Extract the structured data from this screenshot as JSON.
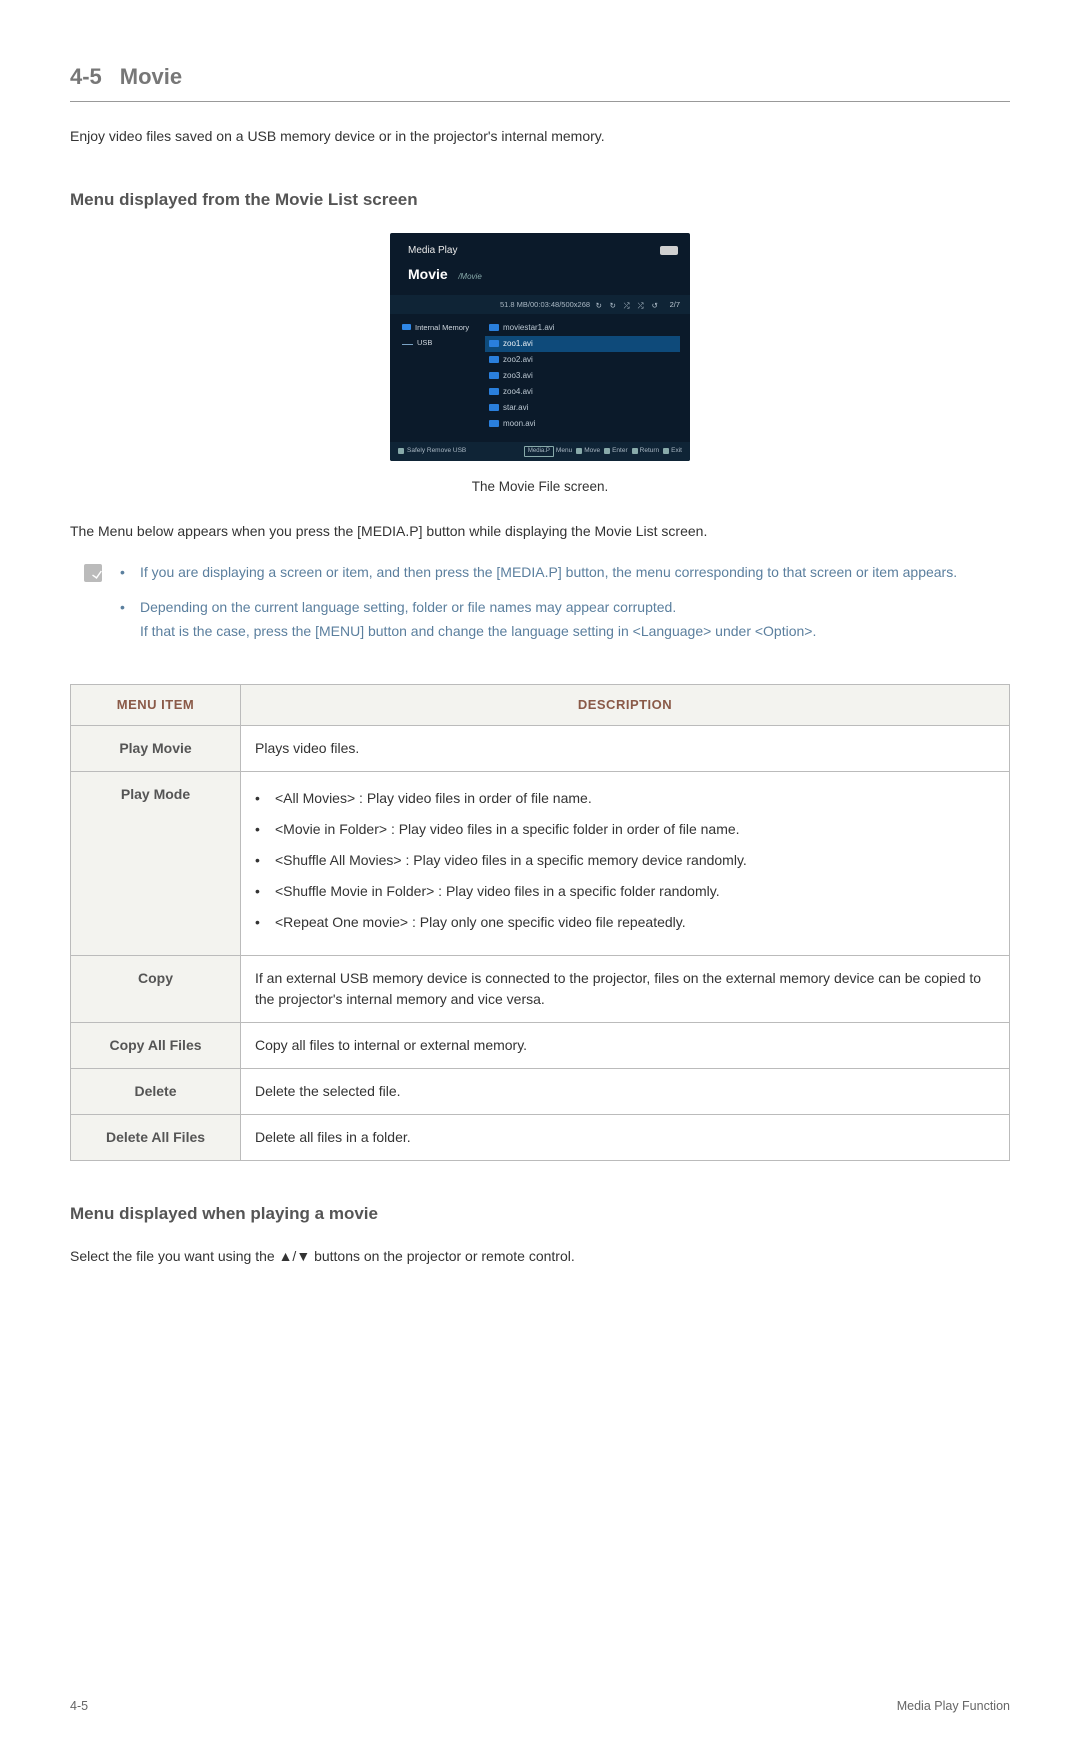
{
  "section": {
    "number": "4-5",
    "title": "Movie"
  },
  "intro": "Enjoy video files saved on a USB memory device or in the projector's internal memory.",
  "sub1": "Menu displayed from the Movie List screen",
  "screenshot": {
    "brand": "Media Play",
    "screen_title": "Movie",
    "breadcrumb": "/Movie",
    "info_bar": "51.8 MB/00:03:48/500x268",
    "page_indicator": "2/7",
    "sidebar": [
      {
        "label": "Internal Memory",
        "icon": "memory"
      },
      {
        "label": "USB",
        "icon": "usb"
      }
    ],
    "files": [
      {
        "name": "moviestar1.avi",
        "selected": false
      },
      {
        "name": "zoo1.avi",
        "selected": true
      },
      {
        "name": "zoo2.avi",
        "selected": false
      },
      {
        "name": "zoo3.avi",
        "selected": false
      },
      {
        "name": "zoo4.avi",
        "selected": false
      },
      {
        "name": "star.avi",
        "selected": false
      },
      {
        "name": "moon.avi",
        "selected": false
      }
    ],
    "footer": {
      "safely_remove": "Safely Remove USB",
      "keys": [
        {
          "tag": "Media.P",
          "label": "Menu"
        },
        {
          "tag": "arrows",
          "label": "Move"
        },
        {
          "tag": "enter",
          "label": "Enter"
        },
        {
          "tag": "return",
          "label": "Return"
        },
        {
          "tag": "exit",
          "label": "Exit"
        }
      ]
    }
  },
  "figure_caption": "The Movie File screen.",
  "below_figure": "The Menu below appears when you press the [MEDIA.P] button while displaying the Movie List screen.",
  "notes": {
    "item1": "If you are displaying a screen or item, and then press the [MEDIA.P] button, the menu corresponding to that screen or item appears.",
    "item2_line1": "Depending on the current language setting, folder or file names may appear corrupted.",
    "item2_line2": "If that is the case, press the [MENU] button and change the language setting in <Language> under <Option>."
  },
  "table": {
    "headers": {
      "col1": "MENU ITEM",
      "col2": "DESCRIPTION"
    },
    "rows": [
      {
        "item": "Play Movie",
        "desc_plain": "Plays video files."
      },
      {
        "item": "Play Mode",
        "desc_list": [
          "<All Movies> : Play video files in order of file name.",
          "<Movie in Folder> : Play video files in a specific folder in order of file name.",
          "<Shuffle All Movies> : Play video files in a specific memory device randomly.",
          "<Shuffle Movie in Folder> : Play video files in a specific folder randomly.",
          "<Repeat One movie> : Play only one specific video file repeatedly."
        ]
      },
      {
        "item": "Copy",
        "desc_plain": "If an external USB memory device is connected to the projector, files on the external memory device can be copied to the projector's internal memory and vice versa."
      },
      {
        "item": "Copy All Files",
        "desc_plain": "Copy all files to internal or external memory."
      },
      {
        "item": "Delete",
        "desc_plain": "Delete the selected file."
      },
      {
        "item": "Delete All Files",
        "desc_plain": "Delete all files in a folder."
      }
    ]
  },
  "sub2": "Menu displayed when playing a movie",
  "sub2_text": "Select the file you want using the ▲/▼ buttons on the projector or remote control.",
  "footer": {
    "left": "4-5",
    "right": "Media Play Function"
  }
}
